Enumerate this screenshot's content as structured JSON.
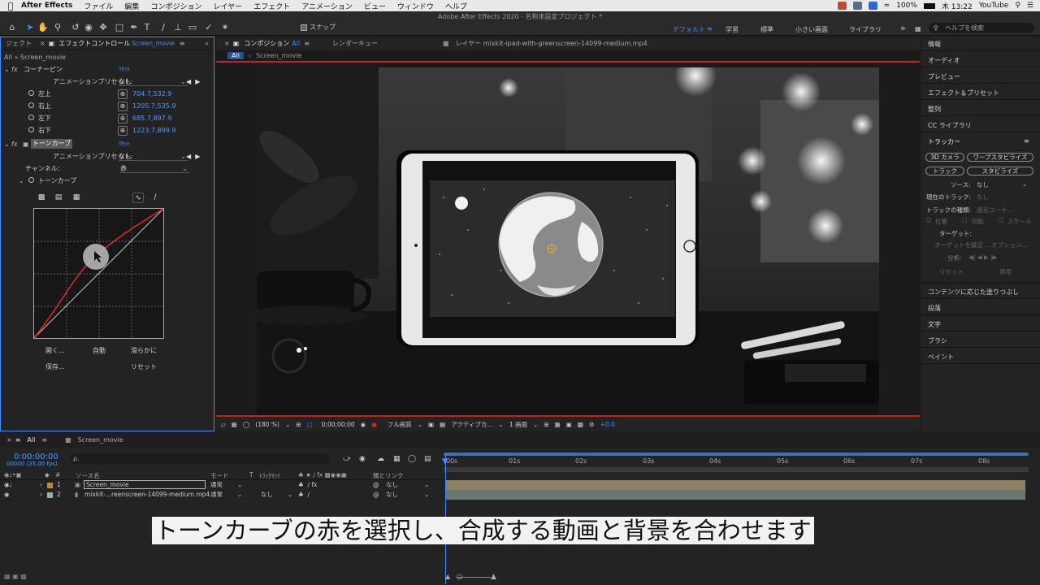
{
  "menubar": {
    "app_name": "After Effects",
    "items": [
      "ファイル",
      "編集",
      "コンポジション",
      "レイヤー",
      "エフェクト",
      "アニメーション",
      "ビュー",
      "ウィンドウ",
      "ヘルプ"
    ],
    "battery": "100%",
    "clock": "木 13:22",
    "user": "YouTube"
  },
  "window_title": "Adobe After Effects 2020 - 名称未設定プロジェクト *",
  "toolbar": {
    "snap_label": "スナップ",
    "workspaces": [
      "デフォルト",
      "学習",
      "標準",
      "小さい画面",
      "ライブラリ"
    ],
    "help_placeholder": "ヘルプを検索"
  },
  "effect_controls": {
    "left_tab": "ジェクト",
    "tab_label": "エフェクトコントロール",
    "tab_target": "Screen_movie",
    "breadcrumb": "All » Screen_movie",
    "corner_pin": {
      "name": "コーナーピン",
      "reset": "ﾘｾｯﾄ",
      "preset_label": "アニメーションプリセット:",
      "preset_value": "なし",
      "params": [
        {
          "label": "左上",
          "value": "704.7,532.9"
        },
        {
          "label": "右上",
          "value": "1205.7,535.9"
        },
        {
          "label": "左下",
          "value": "685.7,897.9"
        },
        {
          "label": "右下",
          "value": "1223.7,899.9"
        }
      ]
    },
    "tone_curve": {
      "name": "トーンカーブ",
      "reset": "ﾘｾｯﾄ",
      "preset_label": "アニメーションプリセット:",
      "preset_value": "なし",
      "channel_label": "チャンネル:",
      "channel_value": "赤",
      "sub_label": "トーンカーブ",
      "actions": [
        "開く...",
        "自動",
        "滑らかに",
        "保存...",
        "リセット"
      ]
    }
  },
  "composition": {
    "tab_label": "コンポジション",
    "tab_target": "All",
    "render_queue": "レンダーキュー",
    "layer_tab": "レイヤー mixkit-ipad-with-greenscreen-14099-medium.mp4",
    "sub_all": "All",
    "sub_name": "Screen_movie",
    "bottom": {
      "zoom": "(180 %)",
      "timecode": "0;00;00;00",
      "resolution": "フル画質",
      "camera": "アクティブカ...",
      "views": "1 画面",
      "exposure": "+0.0"
    }
  },
  "right_panel": {
    "items_top": [
      "情報",
      "オーディオ",
      "プレビュー",
      "エフェクト＆プリセット",
      "整列",
      "CC ライブラリ"
    ],
    "tracker": {
      "title": "トラッカー",
      "buttons": [
        "3D カメラ",
        "ワープスタビライズ",
        "トラック",
        "スタビライズ"
      ],
      "source_label": "ソース:",
      "source_value": "なし",
      "current_track_label": "現在のトラック:",
      "current_track_value": "なし",
      "track_type_label": "トラックの種類:",
      "track_type_value": "遠近コーナ...",
      "checks": [
        "位置",
        "回転",
        "スケール"
      ],
      "target_label": "ターゲット:",
      "set_target": "ターゲットを設定...",
      "options": "オプション...",
      "analyze_label": "分析:",
      "reset": "リセット",
      "apply": "適用"
    },
    "items_bottom": [
      "コンテンツに応じた塗りつぶし",
      "段落",
      "文字",
      "ブラシ",
      "ペイント"
    ]
  },
  "timeline": {
    "tabs": [
      "All",
      "Screen_movie"
    ],
    "timecode": "0:00:00:00",
    "fps": "00000 (25.00 fps)",
    "search_placeholder": "ρ.",
    "columns": {
      "source": "ソース名",
      "mode": "モード",
      "t": "T",
      "trkmat": "ﾄﾗｯｸﾏｯﾄ",
      "parent": "親とリンク"
    },
    "layers": [
      {
        "num": "1",
        "name": "Screen_movie",
        "mode": "通常",
        "trkmat": "",
        "parent": "なし"
      },
      {
        "num": "2",
        "name": "mixkit-...reenscreen-14099-medium.mp4",
        "mode": "通常",
        "trkmat": "なし",
        "parent": "なし"
      }
    ],
    "ruler": [
      "00s",
      "01s",
      "02s",
      "03s",
      "04s",
      "05s",
      "06s",
      "07s",
      "08s"
    ]
  },
  "caption": "トーンカーブの赤を選択し、合成する動画と背景を合わせます",
  "colors": {
    "accent_blue": "#3d8eff",
    "curve_red": "#d8242a",
    "layer1_bar": "#8f8063",
    "layer2_bar": "#69786e"
  }
}
